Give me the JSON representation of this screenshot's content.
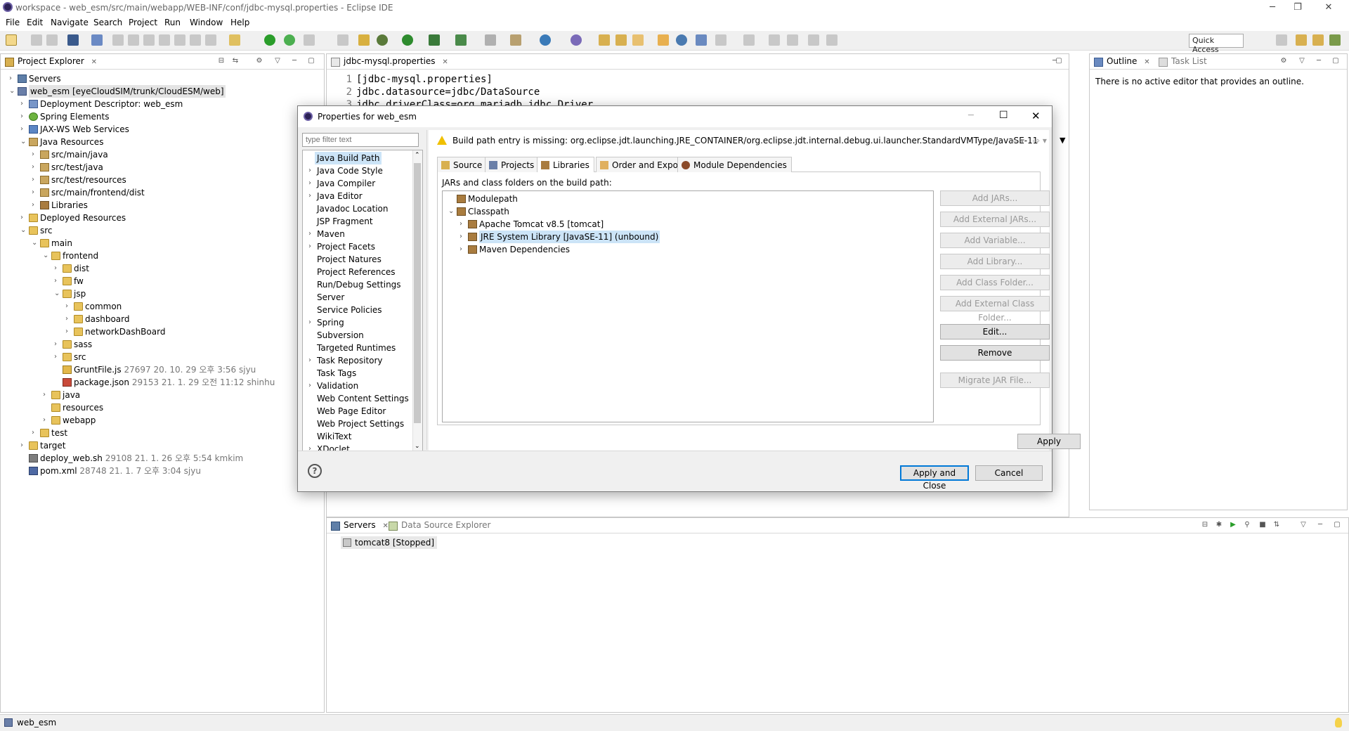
{
  "window": {
    "title": "workspace - web_esm/src/main/webapp/WEB-INF/conf/jdbc-mysql.properties - Eclipse IDE"
  },
  "menu": [
    "File",
    "Edit",
    "Navigate",
    "Search",
    "Project",
    "Run",
    "Window",
    "Help"
  ],
  "toolbar": {
    "quick_access": "Quick Access"
  },
  "project_explorer": {
    "tab_label": "Project Explorer",
    "tree": [
      {
        "label": "Servers",
        "meta": ""
      },
      {
        "label": "web_esm [eyeCloudSIM/trunk/CloudESM/web]",
        "meta": ""
      },
      {
        "label": "Deployment Descriptor: web_esm",
        "meta": ""
      },
      {
        "label": "Spring Elements",
        "meta": ""
      },
      {
        "label": "JAX-WS Web Services",
        "meta": ""
      },
      {
        "label": "Java Resources",
        "meta": ""
      },
      {
        "label": "src/main/java",
        "meta": ""
      },
      {
        "label": "src/test/java",
        "meta": ""
      },
      {
        "label": "src/test/resources",
        "meta": ""
      },
      {
        "label": "src/main/frontend/dist",
        "meta": ""
      },
      {
        "label": "Libraries",
        "meta": ""
      },
      {
        "label": "Deployed Resources",
        "meta": ""
      },
      {
        "label": "src",
        "meta": ""
      },
      {
        "label": "main",
        "meta": ""
      },
      {
        "label": "frontend",
        "meta": ""
      },
      {
        "label": "dist",
        "meta": ""
      },
      {
        "label": "fw",
        "meta": ""
      },
      {
        "label": "jsp",
        "meta": ""
      },
      {
        "label": "common",
        "meta": ""
      },
      {
        "label": "dashboard",
        "meta": ""
      },
      {
        "label": "networkDashBoard",
        "meta": ""
      },
      {
        "label": "sass",
        "meta": ""
      },
      {
        "label": "src",
        "meta": ""
      },
      {
        "label": "GruntFile.js",
        "meta": "27697  20. 10. 29 오후 3:56  sjyu"
      },
      {
        "label": "package.json",
        "meta": "29153  21. 1. 29 오전 11:12  shinhu"
      },
      {
        "label": "java",
        "meta": ""
      },
      {
        "label": "resources",
        "meta": ""
      },
      {
        "label": "webapp",
        "meta": ""
      },
      {
        "label": "test",
        "meta": ""
      },
      {
        "label": "target",
        "meta": ""
      },
      {
        "label": "deploy_web.sh",
        "meta": "29108  21. 1. 26 오후 5:54  kmkim"
      },
      {
        "label": "pom.xml",
        "meta": "28748  21. 1. 7 오후 3:04  sjyu"
      }
    ]
  },
  "editor": {
    "tab_label": "jdbc-mysql.properties",
    "lines": [
      {
        "n": "1",
        "text": "[jdbc-mysql.properties]"
      },
      {
        "n": "2",
        "text": "jdbc.datasource=jdbc/DataSource"
      },
      {
        "n": "3",
        "text": "jdbc.driverClass=org.mariadb.jdbc.Driver"
      }
    ]
  },
  "outline": {
    "tab_outline": "Outline",
    "tab_tasklist": "Task List",
    "message": "There is no active editor that provides an outline."
  },
  "servers_view": {
    "tab_servers": "Servers",
    "tab_datasource": "Data Source Explorer",
    "server_row": "tomcat8  [Stopped]"
  },
  "status": {
    "text": "web_esm"
  },
  "dialog": {
    "title": "Properties for web_esm",
    "filter_placeholder": "type filter text",
    "nav": [
      {
        "label": "Java Build Path",
        "expandable": false,
        "selected": true
      },
      {
        "label": "Java Code Style",
        "expandable": true
      },
      {
        "label": "Java Compiler",
        "expandable": true
      },
      {
        "label": "Java Editor",
        "expandable": true
      },
      {
        "label": "Javadoc Location",
        "expandable": false
      },
      {
        "label": "JSP Fragment",
        "expandable": false
      },
      {
        "label": "Maven",
        "expandable": true
      },
      {
        "label": "Project Facets",
        "expandable": true
      },
      {
        "label": "Project Natures",
        "expandable": false
      },
      {
        "label": "Project References",
        "expandable": false
      },
      {
        "label": "Run/Debug Settings",
        "expandable": false
      },
      {
        "label": "Server",
        "expandable": false
      },
      {
        "label": "Service Policies",
        "expandable": false
      },
      {
        "label": "Spring",
        "expandable": true
      },
      {
        "label": "Subversion",
        "expandable": false
      },
      {
        "label": "Targeted Runtimes",
        "expandable": false
      },
      {
        "label": "Task Repository",
        "expandable": true
      },
      {
        "label": "Task Tags",
        "expandable": false
      },
      {
        "label": "Validation",
        "expandable": true
      },
      {
        "label": "Web Content Settings",
        "expandable": false
      },
      {
        "label": "Web Page Editor",
        "expandable": false
      },
      {
        "label": "Web Project Settings",
        "expandable": false
      },
      {
        "label": "WikiText",
        "expandable": false
      },
      {
        "label": "XDoclet",
        "expandable": true
      }
    ],
    "warning": "Build path entry is missing: org.eclipse.jdt.launching.JRE_CONTAINER/org.eclipse.jdt.internal.debug.ui.launcher.StandardVMType/JavaSE-11",
    "tabs": [
      "Source",
      "Projects",
      "Libraries",
      "Order and Export",
      "Module Dependencies"
    ],
    "active_tab": "Libraries",
    "caption": "JARs and class folders on the build path:",
    "classpath_tree": [
      {
        "label": "Modulepath"
      },
      {
        "label": "Classpath"
      },
      {
        "label": "Apache Tomcat v8.5 [tomcat]"
      },
      {
        "label": "JRE System Library [JavaSE-11] (unbound)"
      },
      {
        "label": "Maven Dependencies"
      }
    ],
    "buttons": {
      "add_jars": "Add JARs...",
      "add_external_jars": "Add External JARs...",
      "add_variable": "Add Variable...",
      "add_library": "Add Library...",
      "add_class_folder": "Add Class Folder...",
      "add_external_class_folder": "Add External Class Folder...",
      "edit": "Edit...",
      "remove": "Remove",
      "migrate_jar": "Migrate JAR File...",
      "apply": "Apply",
      "apply_and_close": "Apply and Close",
      "cancel": "Cancel"
    }
  }
}
